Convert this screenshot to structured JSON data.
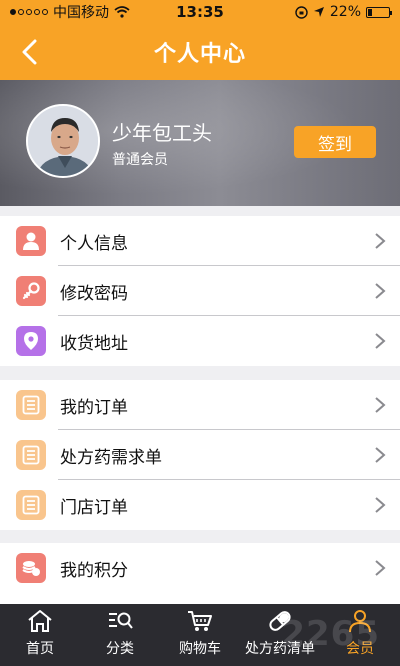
{
  "status": {
    "carrier": "中国移动",
    "time": "13:35",
    "battery": "22%",
    "battery_level": 0.22
  },
  "nav": {
    "title": "个人中心",
    "back_icon": "chevron-left-icon"
  },
  "profile": {
    "name": "少年包工头",
    "level": "普通会员",
    "checkin_label": "签到"
  },
  "menu": {
    "group1": [
      {
        "label": "个人信息",
        "icon": "user-icon",
        "color": "#f07f75"
      },
      {
        "label": "修改密码",
        "icon": "key-icon",
        "color": "#f07f75"
      },
      {
        "label": "收货地址",
        "icon": "location-pin-icon",
        "color": "#b571e8"
      }
    ],
    "group2": [
      {
        "label": "我的订单",
        "icon": "order-list-icon",
        "color": "#f9c58d"
      },
      {
        "label": "处方药需求单",
        "icon": "order-list-icon",
        "color": "#f9c58d"
      },
      {
        "label": "门店订单",
        "icon": "order-list-icon",
        "color": "#f9c58d"
      }
    ],
    "group3": [
      {
        "label": "我的积分",
        "icon": "coins-icon",
        "color": "#f07f75"
      }
    ]
  },
  "tabs": [
    {
      "label": "首页",
      "icon": "home-icon"
    },
    {
      "label": "分类",
      "icon": "search-list-icon"
    },
    {
      "label": "购物车",
      "icon": "cart-icon"
    },
    {
      "label": "处方药清单",
      "icon": "pill-icon"
    },
    {
      "label": "会员",
      "icon": "member-icon",
      "active": true
    }
  ],
  "watermark": "2265"
}
